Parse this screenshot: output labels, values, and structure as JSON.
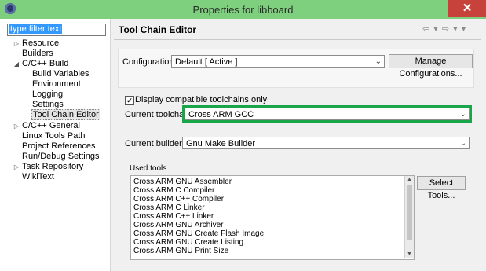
{
  "window": {
    "title": "Properties for libboard",
    "close_glyph": "✕",
    "icon": "eclipse-icon"
  },
  "nav": {
    "filter_text": "type filter text",
    "items": [
      {
        "label": "Resource",
        "arrow": "▷"
      },
      {
        "label": "Builders",
        "arrow": ""
      },
      {
        "label": "C/C++ Build",
        "arrow": "◢"
      },
      {
        "label": "Build Variables",
        "arrow": ""
      },
      {
        "label": "Environment",
        "arrow": ""
      },
      {
        "label": "Logging",
        "arrow": ""
      },
      {
        "label": "Settings",
        "arrow": ""
      },
      {
        "label": "Tool Chain Editor",
        "arrow": ""
      },
      {
        "label": "C/C++ General",
        "arrow": "▷"
      },
      {
        "label": "Linux Tools Path",
        "arrow": ""
      },
      {
        "label": "Project References",
        "arrow": ""
      },
      {
        "label": "Run/Debug Settings",
        "arrow": ""
      },
      {
        "label": "Task Repository",
        "arrow": "▷"
      },
      {
        "label": "WikiText",
        "arrow": ""
      }
    ]
  },
  "editor": {
    "title": "Tool Chain Editor",
    "nav_glyphs": "⇦ ▾ ⇨ ▾ ▾",
    "configuration_label": "Configuration:",
    "configuration_value": "Default  [ Active ]",
    "manage_button": "Manage Configurations...",
    "display_compatible_label": "Display compatible toolchains only",
    "display_compatible_checked": "✔",
    "current_toolchain_label": "Current toolchain:",
    "current_toolchain_value": "Cross ARM GCC",
    "current_builder_label": "Current builder:",
    "current_builder_value": "Gnu Make Builder",
    "used_tools_label": "Used tools",
    "select_tools_button": "Select Tools...",
    "tools": [
      "Cross ARM GNU Assembler",
      "Cross ARM C Compiler",
      "Cross ARM C++ Compiler",
      "Cross ARM C Linker",
      "Cross ARM C++ Linker",
      "Cross ARM GNU Archiver",
      "Cross ARM GNU Create Flash Image",
      "Cross ARM GNU Create Listing",
      "Cross ARM GNU Print Size"
    ],
    "dropdown_glyph": "⌄",
    "scroll_up": "▲",
    "scroll_down": "▼",
    "highlight_color": "#1aa54a"
  }
}
